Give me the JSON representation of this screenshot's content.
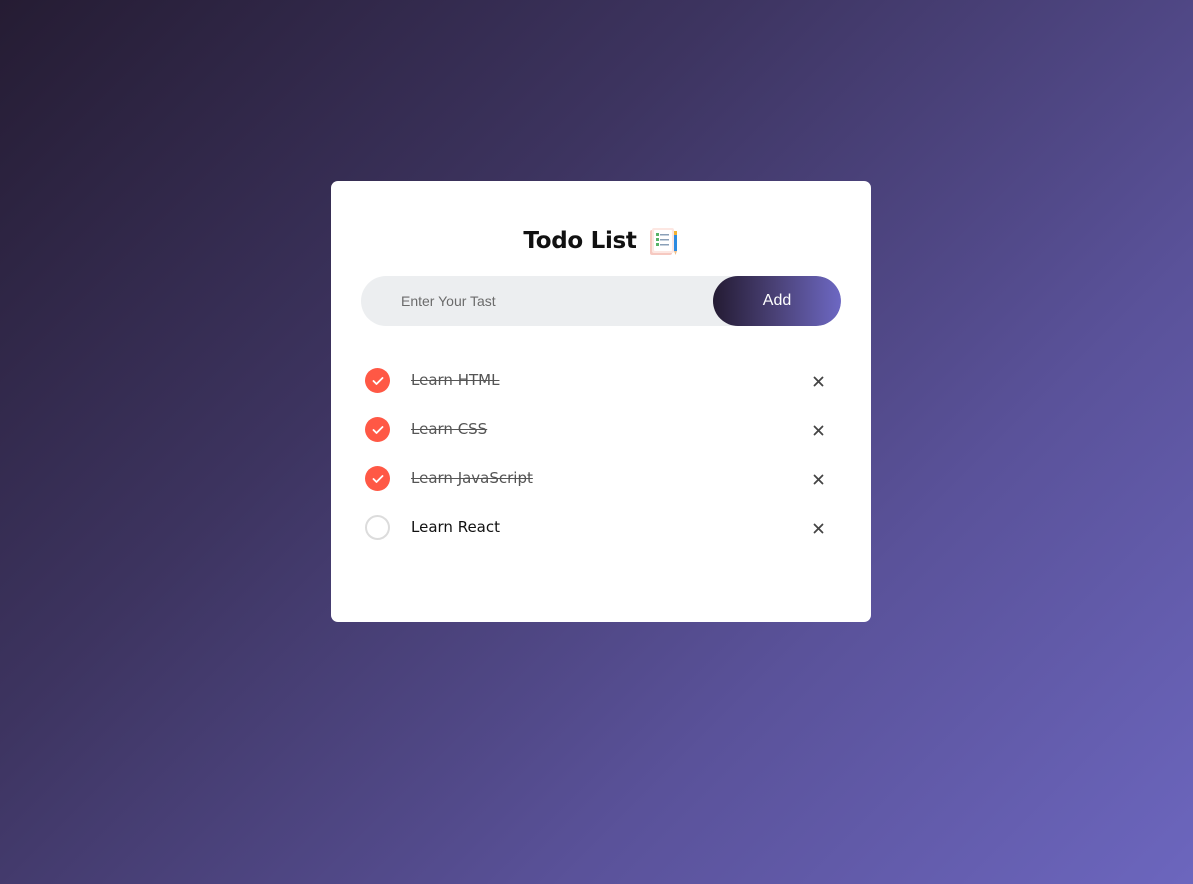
{
  "header": {
    "title": "Todo List",
    "title_icon": "notepad-checklist-icon"
  },
  "input": {
    "placeholder": "Enter Your Tast",
    "value": "",
    "add_label": "Add"
  },
  "todos": [
    {
      "text": "Learn HTML",
      "done": true
    },
    {
      "text": "Learn CSS",
      "done": true
    },
    {
      "text": "Learn JavaScript",
      "done": true
    },
    {
      "text": "Learn React",
      "done": false
    }
  ],
  "icons": {
    "checked": "check-icon",
    "unchecked": "circle-icon",
    "delete": "close-icon"
  },
  "colors": {
    "accent": "#ff5845",
    "button_gradient_start": "#241b33",
    "button_gradient_end": "#6d68c3",
    "input_background": "#eceef0",
    "card_background": "#ffffff"
  }
}
